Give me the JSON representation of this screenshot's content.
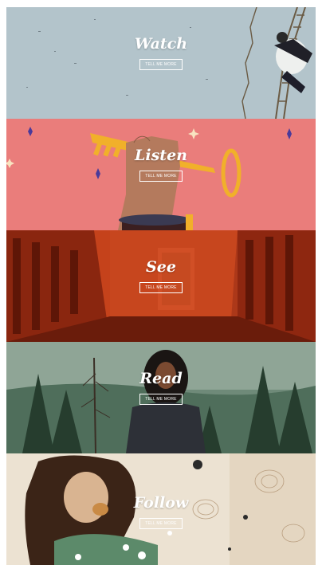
{
  "panels": [
    {
      "title": "Watch",
      "button": "TELL ME MORE",
      "bg": "#b9c9cf"
    },
    {
      "title": "Listen",
      "button": "TELL ME MORE",
      "bg": "#ea7d7b"
    },
    {
      "title": "See",
      "button": "TELL ME MORE",
      "bg": "#c3401b"
    },
    {
      "title": "Read",
      "button": "TELL ME MORE",
      "bg": "#3d5a49"
    },
    {
      "title": "Follow",
      "button": "TELL ME MORE",
      "bg": "#ece2d2"
    }
  ]
}
